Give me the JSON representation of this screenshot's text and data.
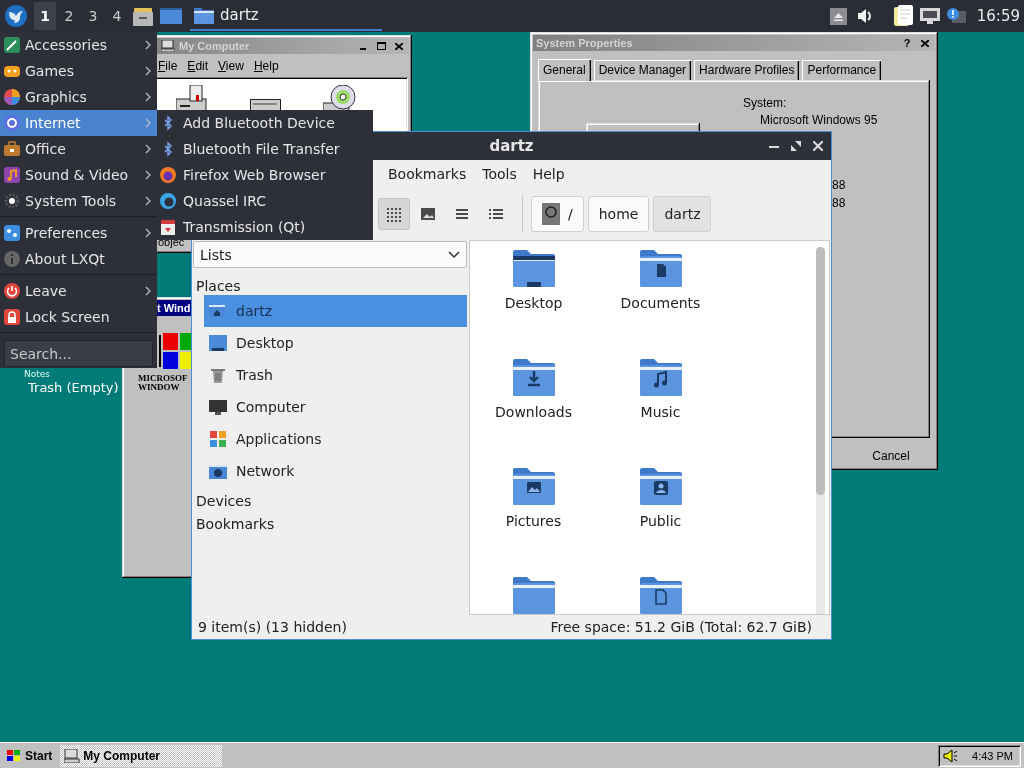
{
  "top_panel": {
    "workspaces": [
      {
        "label": "1",
        "selected": true
      },
      {
        "label": "2",
        "selected": false
      },
      {
        "label": "3",
        "selected": false
      },
      {
        "label": "4",
        "selected": false
      }
    ],
    "tasks": [
      {
        "label": "dartz",
        "selected": true
      }
    ],
    "clock": "16:59"
  },
  "desktop": {
    "notes_label": "Notes",
    "trash_label": "Trash (Empty)"
  },
  "my_computer_window": {
    "title": "My Computer",
    "menu": [
      "File",
      "Edit",
      "View",
      "Help"
    ],
    "status": "objec"
  },
  "welcome_window": {
    "title": "t Wind",
    "logo_lines": [
      "MICROSOF",
      "WINDOW"
    ]
  },
  "system_properties": {
    "title": "System Properties",
    "help_button": "?",
    "tabs": [
      {
        "label": "General",
        "selected": true
      },
      {
        "label": "Device Manager",
        "selected": false
      },
      {
        "label": "Hardware Profiles",
        "selected": false
      },
      {
        "label": "Performance",
        "selected": false
      }
    ],
    "system_label": "System:",
    "system_lines": [
      "Microsoft Windows 95",
      "88",
      "88"
    ],
    "buttons": [
      "Cancel"
    ]
  },
  "file_manager": {
    "title": "dartz",
    "menu": [
      "Bookmarks",
      "Tools",
      "Help"
    ],
    "view_modes": [
      {
        "kind": "icons",
        "selected": true
      },
      {
        "kind": "thumbnails",
        "selected": false
      },
      {
        "kind": "compact",
        "selected": false
      },
      {
        "kind": "details",
        "selected": false
      }
    ],
    "path": [
      {
        "label": "/",
        "selected": false
      },
      {
        "label": "home",
        "selected": false
      },
      {
        "label": "dartz",
        "selected": true
      }
    ],
    "side_view": "Lists",
    "places_heading": "Places",
    "places": [
      {
        "label": "dartz",
        "kind": "home",
        "selected": true
      },
      {
        "label": "Desktop",
        "kind": "desktop",
        "selected": false
      },
      {
        "label": "Trash",
        "kind": "trash",
        "selected": false
      },
      {
        "label": "Computer",
        "kind": "computer",
        "selected": false
      },
      {
        "label": "Applications",
        "kind": "applications",
        "selected": false
      },
      {
        "label": "Network",
        "kind": "network",
        "selected": false
      }
    ],
    "sections": [
      "Devices",
      "Bookmarks"
    ],
    "items": [
      {
        "label": "Desktop",
        "kind": "desktop"
      },
      {
        "label": "Documents",
        "kind": "documents"
      },
      {
        "label": "Downloads",
        "kind": "downloads"
      },
      {
        "label": "Music",
        "kind": "music"
      },
      {
        "label": "Pictures",
        "kind": "pictures"
      },
      {
        "label": "Public",
        "kind": "public"
      },
      {
        "kind": "folder"
      },
      {
        "kind": "templates"
      }
    ],
    "status_left": "9 item(s) (13 hidden)",
    "status_right": "Free space: 51.2 GiB (Total: 62.7 GiB)"
  },
  "app_menu": {
    "groups": [
      {
        "items": [
          {
            "label": "Accessories",
            "kind": "accessories",
            "submenu": true,
            "selected": false
          },
          {
            "label": "Games",
            "kind": "games",
            "submenu": true,
            "selected": false
          },
          {
            "label": "Graphics",
            "kind": "graphics",
            "submenu": true,
            "selected": false
          },
          {
            "label": "Internet",
            "kind": "internet",
            "submenu": true,
            "selected": true
          },
          {
            "label": "Office",
            "kind": "office",
            "submenu": true,
            "selected": false
          },
          {
            "label": "Sound & Video",
            "kind": "multimedia",
            "submenu": true,
            "selected": false
          },
          {
            "label": "System Tools",
            "kind": "system",
            "submenu": true,
            "selected": false
          }
        ]
      },
      {
        "items": [
          {
            "label": "Preferences",
            "kind": "preferences",
            "submenu": true,
            "selected": false
          },
          {
            "label": "About LXQt",
            "kind": "about",
            "submenu": false,
            "selected": false
          }
        ]
      },
      {
        "items": [
          {
            "label": "Leave",
            "kind": "leave",
            "submenu": true,
            "selected": false
          },
          {
            "label": "Lock Screen",
            "kind": "lock",
            "submenu": false,
            "selected": false
          }
        ]
      }
    ],
    "search": {
      "placeholder": "Search..."
    },
    "submenu_items": [
      {
        "label": "Add Bluetooth Device",
        "kind": "bluetooth"
      },
      {
        "label": "Bluetooth File Transfer",
        "kind": "bluetooth"
      },
      {
        "label": "Firefox Web Browser",
        "kind": "browser"
      },
      {
        "label": "Quassel IRC",
        "kind": "chat"
      },
      {
        "label": "Transmission (Qt)",
        "kind": "torrent"
      }
    ]
  },
  "taskbar": {
    "start": "Start",
    "tasks": [
      {
        "label": "My Computer",
        "selected": true
      }
    ],
    "clock": "4:43 PM"
  }
}
